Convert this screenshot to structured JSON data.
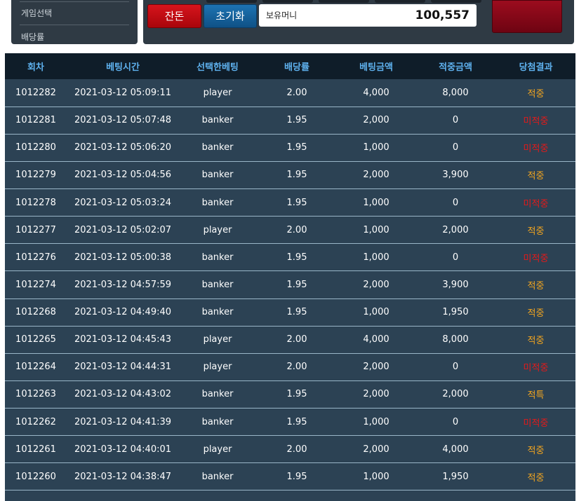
{
  "sidebar": {
    "items": [
      {
        "label": "게임선택"
      },
      {
        "label": "배당률"
      }
    ]
  },
  "controls": {
    "change_label": "잔돈",
    "reset_label": "초기화",
    "money_label": "보유머니",
    "money_value": "100,557"
  },
  "colors": {
    "header_bg": "#0f1d29",
    "header_text": "#5eb1ee",
    "row_bg": "#2c4254",
    "hit": "#f2a51f",
    "miss": "#e31a1a",
    "change_button": "#c40f17",
    "reset_button": "#1763a0"
  },
  "table": {
    "headers": [
      "회차",
      "베팅시간",
      "선택한베팅",
      "배당률",
      "베팅금액",
      "적중금액",
      "당첨결과"
    ],
    "rows": [
      {
        "round": "1012282",
        "time": "2021-03-12 05:09:11",
        "pick": "player",
        "odds": "2.00",
        "bet": "4,000",
        "win": "8,000",
        "result": "적중",
        "status": "hit"
      },
      {
        "round": "1012281",
        "time": "2021-03-12 05:07:48",
        "pick": "banker",
        "odds": "1.95",
        "bet": "2,000",
        "win": "0",
        "result": "미적중",
        "status": "miss"
      },
      {
        "round": "1012280",
        "time": "2021-03-12 05:06:20",
        "pick": "banker",
        "odds": "1.95",
        "bet": "1,000",
        "win": "0",
        "result": "미적중",
        "status": "miss"
      },
      {
        "round": "1012279",
        "time": "2021-03-12 05:04:56",
        "pick": "banker",
        "odds": "1.95",
        "bet": "2,000",
        "win": "3,900",
        "result": "적중",
        "status": "hit"
      },
      {
        "round": "1012278",
        "time": "2021-03-12 05:03:24",
        "pick": "banker",
        "odds": "1.95",
        "bet": "1,000",
        "win": "0",
        "result": "미적중",
        "status": "miss"
      },
      {
        "round": "1012277",
        "time": "2021-03-12 05:02:07",
        "pick": "player",
        "odds": "2.00",
        "bet": "1,000",
        "win": "2,000",
        "result": "적중",
        "status": "hit"
      },
      {
        "round": "1012276",
        "time": "2021-03-12 05:00:38",
        "pick": "banker",
        "odds": "1.95",
        "bet": "1,000",
        "win": "0",
        "result": "미적중",
        "status": "miss"
      },
      {
        "round": "1012274",
        "time": "2021-03-12 04:57:59",
        "pick": "banker",
        "odds": "1.95",
        "bet": "2,000",
        "win": "3,900",
        "result": "적중",
        "status": "hit"
      },
      {
        "round": "1012268",
        "time": "2021-03-12 04:49:40",
        "pick": "banker",
        "odds": "1.95",
        "bet": "1,000",
        "win": "1,950",
        "result": "적중",
        "status": "hit"
      },
      {
        "round": "1012265",
        "time": "2021-03-12 04:45:43",
        "pick": "player",
        "odds": "2.00",
        "bet": "4,000",
        "win": "8,000",
        "result": "적중",
        "status": "hit"
      },
      {
        "round": "1012264",
        "time": "2021-03-12 04:44:31",
        "pick": "player",
        "odds": "2.00",
        "bet": "2,000",
        "win": "0",
        "result": "미적중",
        "status": "miss"
      },
      {
        "round": "1012263",
        "time": "2021-03-12 04:43:02",
        "pick": "banker",
        "odds": "1.95",
        "bet": "2,000",
        "win": "2,000",
        "result": "적특",
        "status": "hit"
      },
      {
        "round": "1012262",
        "time": "2021-03-12 04:41:39",
        "pick": "banker",
        "odds": "1.95",
        "bet": "1,000",
        "win": "0",
        "result": "미적중",
        "status": "miss"
      },
      {
        "round": "1012261",
        "time": "2021-03-12 04:40:01",
        "pick": "player",
        "odds": "2.00",
        "bet": "2,000",
        "win": "4,000",
        "result": "적중",
        "status": "hit"
      },
      {
        "round": "1012260",
        "time": "2021-03-12 04:38:47",
        "pick": "banker",
        "odds": "1.95",
        "bet": "1,000",
        "win": "1,950",
        "result": "적중",
        "status": "hit"
      }
    ]
  }
}
